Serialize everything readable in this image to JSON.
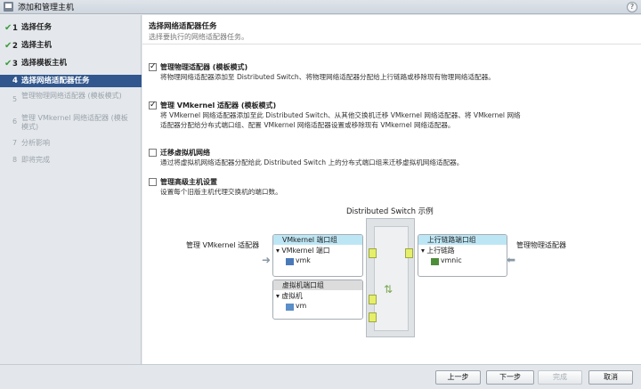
{
  "window": {
    "title": "添加和管理主机",
    "help": "?"
  },
  "sidebar": {
    "steps": [
      {
        "num": "1",
        "label": "选择任务",
        "state": "done"
      },
      {
        "num": "2",
        "label": "选择主机",
        "state": "done"
      },
      {
        "num": "3",
        "label": "选择模板主机",
        "state": "done"
      },
      {
        "num": "4",
        "label": "选择网络适配器任务",
        "state": "active"
      },
      {
        "num": "5",
        "label": "管理物理网络适配器 (模板模式)",
        "state": "disabled"
      },
      {
        "num": "6",
        "label": "管理 VMkernel 网络适配器 (模板模式)",
        "state": "disabled"
      },
      {
        "num": "7",
        "label": "分析影响",
        "state": "disabled"
      },
      {
        "num": "8",
        "label": "即将完成",
        "state": "disabled"
      }
    ]
  },
  "header": {
    "title": "选择网络适配器任务",
    "subtitle": "选择要执行的网络适配器任务。"
  },
  "options": [
    {
      "checked": true,
      "title": "管理物理适配器 (模板模式)",
      "description": "将物理网络适配器添加至 Distributed Switch、将物理网络适配器分配给上行链路或移除现有物理网络适配器。"
    },
    {
      "checked": true,
      "title": "管理 VMkernel 适配器 (模板模式)",
      "description": "将 VMkernel 网络适配器添加至此 Distributed Switch、从其他交换机迁移 VMkernel 网络适配器、将 VMkernel 网络适配器分配给分布式端口组、配置 VMkernel 网络适配器设置或移除现有 VMkernel 网络适配器。"
    },
    {
      "checked": false,
      "title": "迁移虚拟机网络",
      "description": "通过将虚拟机网络适配器分配给此 Distributed Switch 上的分布式端口组来迁移虚拟机网络适配器。"
    },
    {
      "checked": false,
      "title": "管理高级主机设置",
      "description": "设置每个旧版主机代理交换机的端口数。"
    }
  ],
  "diagram": {
    "title": "Distributed Switch 示例",
    "left_label": "管理 VMkernel 适配器",
    "right_label": "管理物理适配器",
    "vmk_group": {
      "header": "VMkernel 端口组",
      "port": "VMkernel 端口",
      "item": "vmk"
    },
    "uplink_group": {
      "header": "上行链路端口组",
      "port": "上行链路",
      "item": "vmnic"
    },
    "vm_group": {
      "header": "虚拟机端口组",
      "port": "虚拟机",
      "item": "vm"
    },
    "colors": {
      "selected_header": "#bde6f5",
      "port": "#e6ef6a",
      "active_step": "#31578e"
    }
  },
  "footer": {
    "back": "上一步",
    "next": "下一步",
    "finish": "完成",
    "cancel": "取消"
  }
}
